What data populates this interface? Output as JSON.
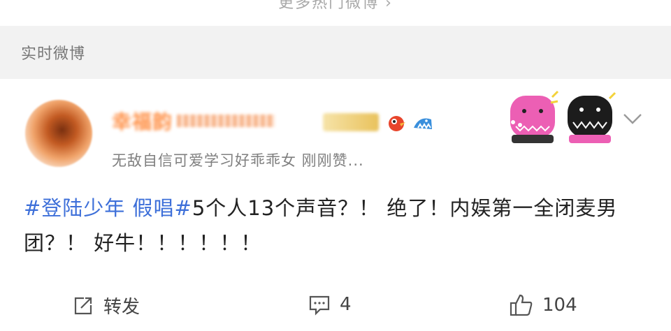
{
  "top_link": {
    "label": "更多热门微博 ›"
  },
  "section": {
    "title": "实时微博"
  },
  "post": {
    "username": "幸福韵",
    "subtitle": "无敌自信可爱学习好乖乖女 刚刚赞...",
    "body": {
      "hashtag": "#登陆少年 假唱#",
      "text": "5个人13个声音？！ 绝了！内娱第一全闭麦男团？！ 好牛！！！！！！"
    }
  },
  "actions": {
    "forward": {
      "icon": "share-icon",
      "label": "转发"
    },
    "comment": {
      "icon": "comment-icon",
      "count": "4"
    },
    "like": {
      "icon": "thumbs-up-icon",
      "count": "104"
    }
  },
  "colors": {
    "hashtag": "#3d6fd9",
    "username": "#ff7f2a",
    "header_bg": "#f2f2f2"
  }
}
